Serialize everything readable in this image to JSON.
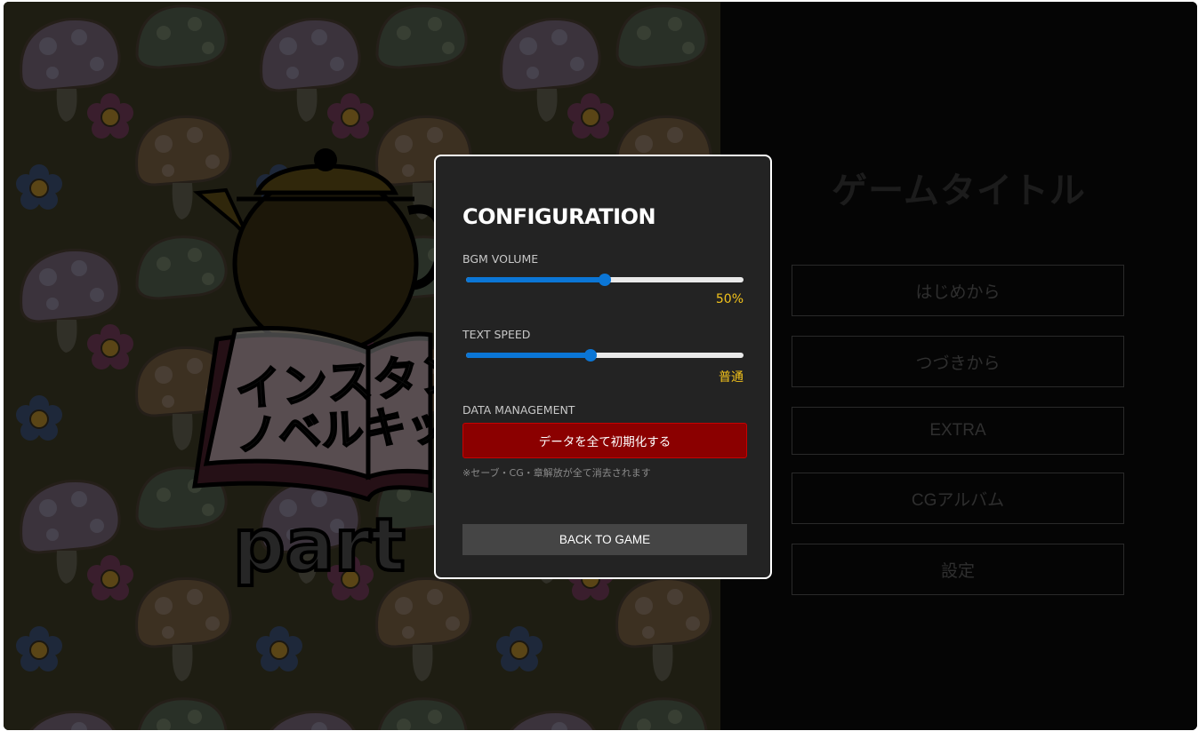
{
  "title_screen": {
    "game_title": "ゲームタイトル",
    "logo_text_line1": "インスタン",
    "logo_text_line2": "ノベルキッ",
    "logo_text_part": "part",
    "menu": [
      {
        "label": "はじめから"
      },
      {
        "label": "つづきから"
      },
      {
        "label": "EXTRA"
      },
      {
        "label": "CGアルバム"
      },
      {
        "label": "設定"
      }
    ]
  },
  "config": {
    "title": "CONFIGURATION",
    "bgm_volume": {
      "label": "BGM VOLUME",
      "value_text": "50%",
      "value": 0.5
    },
    "text_speed": {
      "label": "TEXT SPEED",
      "value_text": "普通",
      "value": 0.45
    },
    "data_management": {
      "label": "DATA MANAGEMENT",
      "reset_button": "データを全て初期化する",
      "note": "※セーブ・CG・章解放が全て消去されます"
    },
    "back_button": "BACK TO GAME"
  },
  "colors": {
    "accent": "#0b76d6",
    "value_text": "#f2c21b",
    "danger": "#8b0000",
    "modal_bg": "#232323"
  }
}
